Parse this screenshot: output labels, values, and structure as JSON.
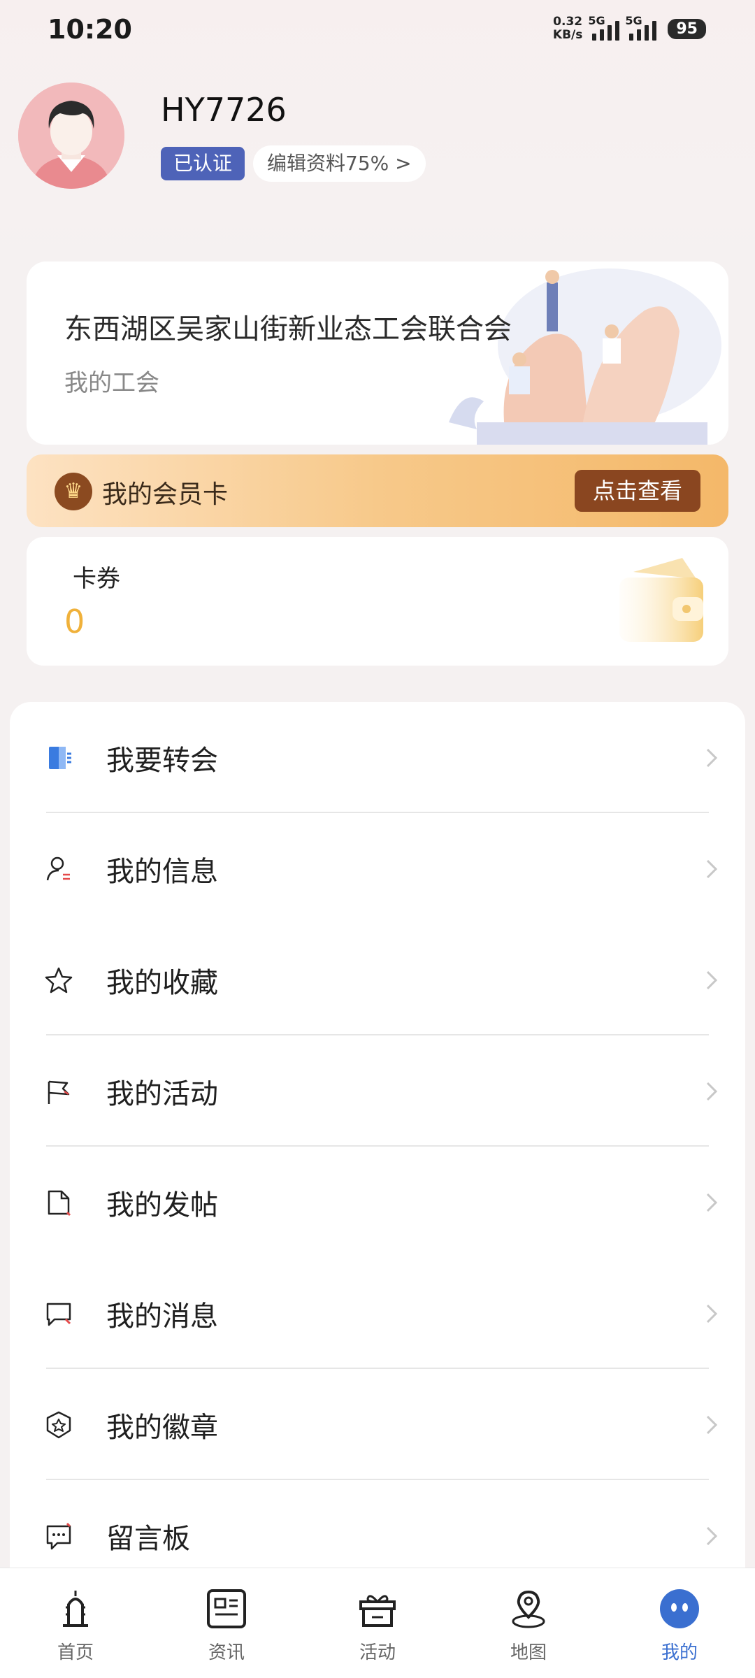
{
  "status_bar": {
    "time": "10:20",
    "net_speed_value": "0.32",
    "net_speed_unit": "KB/s",
    "signal1_label": "5G",
    "signal2_label": "5G",
    "battery": "95"
  },
  "profile": {
    "username": "HY7726",
    "verified_label": "已认证",
    "edit_label": "编辑资料75%  >"
  },
  "union": {
    "title": "东西湖区吴家山街新业态工会联合会",
    "subtitle": "我的工会"
  },
  "member_card": {
    "label": "我的会员卡",
    "button": "点击查看"
  },
  "coupon": {
    "label": "卡券",
    "value": "0"
  },
  "menu": [
    {
      "label": "我要转会",
      "icon": "transfer-door-icon"
    },
    {
      "label": "我的信息",
      "icon": "user-info-icon"
    },
    {
      "label": "我的收藏",
      "icon": "star-icon"
    },
    {
      "label": "我的活动",
      "icon": "flag-icon"
    },
    {
      "label": "我的发帖",
      "icon": "document-icon"
    },
    {
      "label": "我的消息",
      "icon": "message-icon"
    },
    {
      "label": "我的徽章",
      "icon": "badge-icon"
    },
    {
      "label": "留言板",
      "icon": "comment-board-icon"
    }
  ],
  "nav": [
    {
      "label": "首页",
      "icon": "home-tower-icon"
    },
    {
      "label": "资讯",
      "icon": "news-icon"
    },
    {
      "label": "活动",
      "icon": "gift-icon"
    },
    {
      "label": "地图",
      "icon": "map-pin-icon"
    },
    {
      "label": "我的",
      "icon": "profile-face-icon",
      "active": true
    }
  ],
  "colors": {
    "accent_blue": "#3a6fd0",
    "verified_bg": "#4e63b8",
    "member_button": "#8a4620",
    "coupon_value": "#f0b13a"
  }
}
